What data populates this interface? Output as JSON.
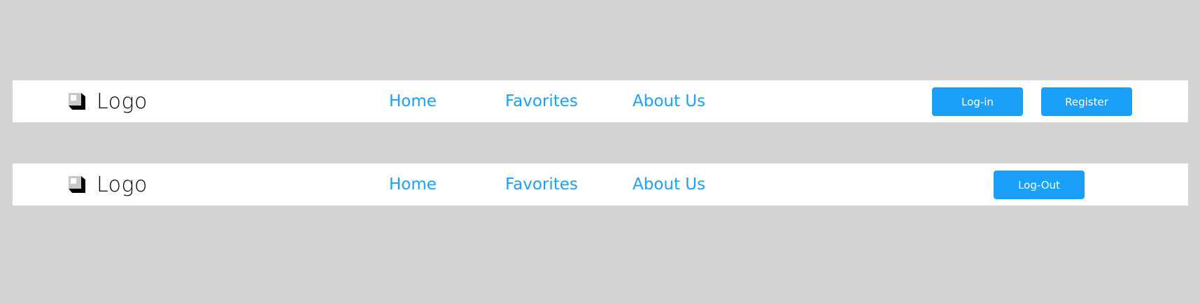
{
  "colors": {
    "background": "#d3d3d3",
    "navbar": "#ffffff",
    "link": "#1aa0f8",
    "button": "#1aa0f8",
    "button_text": "#ffffff"
  },
  "navbars": [
    {
      "brand": {
        "icon": "logo-cube-icon",
        "text": "Logo"
      },
      "links": [
        "Home",
        "Favorites",
        "About Us"
      ],
      "buttons": [
        "Log-in",
        "Register"
      ]
    },
    {
      "brand": {
        "icon": "logo-cube-icon",
        "text": "Logo"
      },
      "links": [
        "Home",
        "Favorites",
        "About Us"
      ],
      "buttons": [
        "Log-Out"
      ]
    }
  ]
}
